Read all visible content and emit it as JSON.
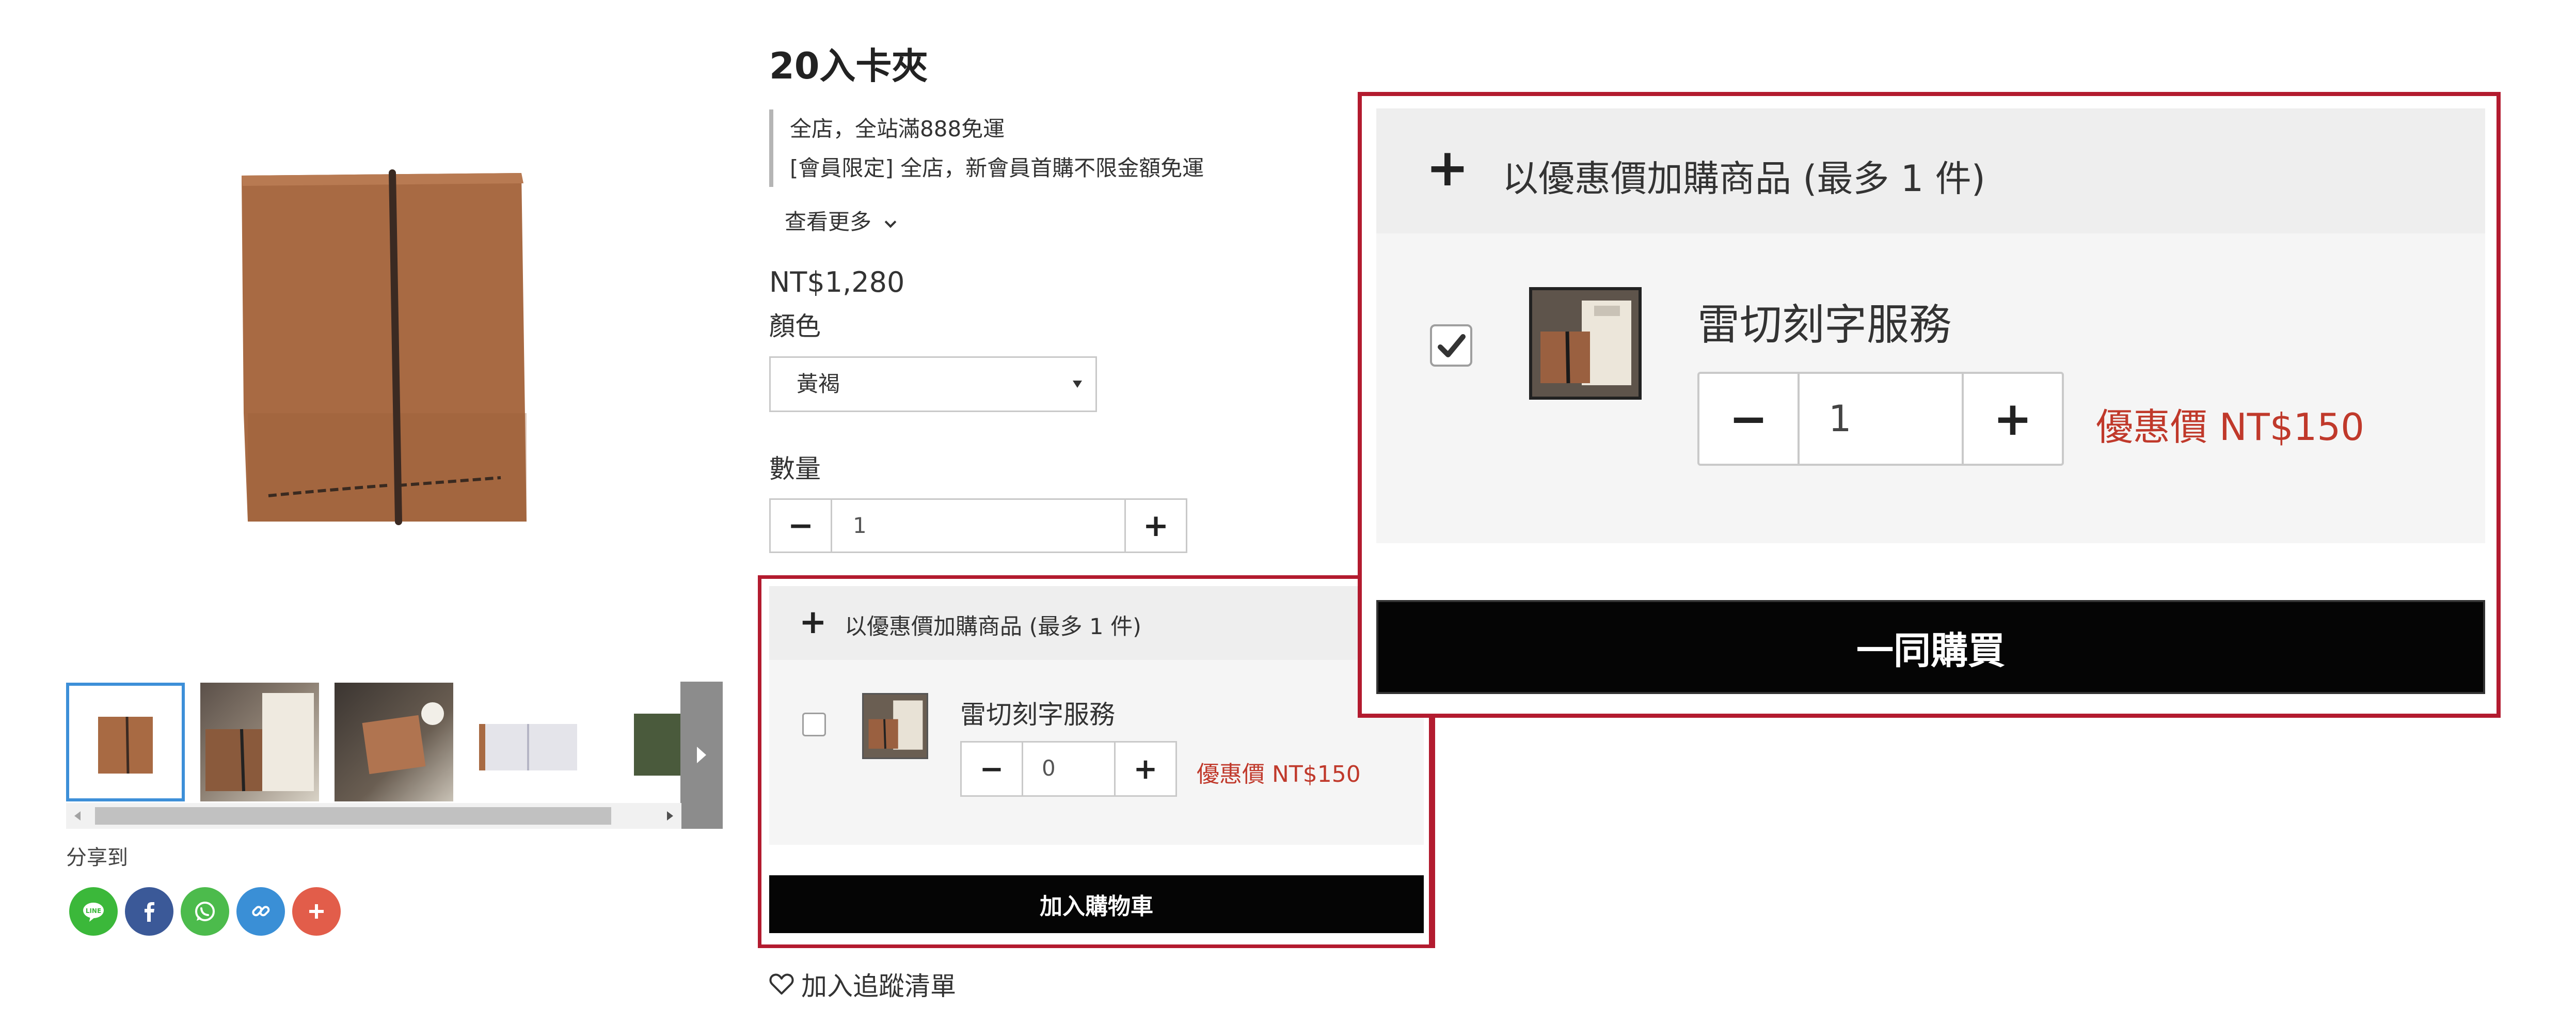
{
  "product": {
    "title": "20入卡夾",
    "promotions": [
      "全店，全站滿888免運",
      "[會員限定] 全店，新會員首購不限金額免運"
    ],
    "see_more": "查看更多",
    "price": "NT$1,280",
    "color_label": "顏色",
    "color_selected": "黃褐",
    "quantity_label": "數量",
    "quantity_value": "1",
    "share_label": "分享到",
    "wishlist_label": "加入追蹤清單"
  },
  "addon": {
    "header": "以優惠價加購商品 (最多 1 件)",
    "item_name": "雷切刻字服務",
    "item_qty": "0",
    "item_price": "優惠價 NT$150",
    "add_to_cart_label": "加入購物車"
  },
  "zoom": {
    "header": "以優惠價加購商品 (最多 1 件)",
    "item_name": "雷切刻字服務",
    "item_qty": "1",
    "item_price": "優惠價 NT$150",
    "buy_together_label": "一同購買"
  },
  "icons": {
    "share": [
      "line-icon",
      "facebook-icon",
      "whatsapp-icon",
      "link-icon",
      "more-share-icon"
    ],
    "stepper": [
      "minus-icon",
      "plus-icon"
    ],
    "wishlist": "heart-icon"
  },
  "colors": {
    "accent_red": "#b31b2f",
    "price_red": "#c0392b",
    "button_black": "#050505",
    "line_green": "#3bb83a",
    "facebook_blue": "#3b5998",
    "whatsapp_green": "#4cbb4c",
    "link_blue": "#3a8fd6",
    "more_red": "#e25d4a",
    "leather_brown": "#a86a43"
  }
}
